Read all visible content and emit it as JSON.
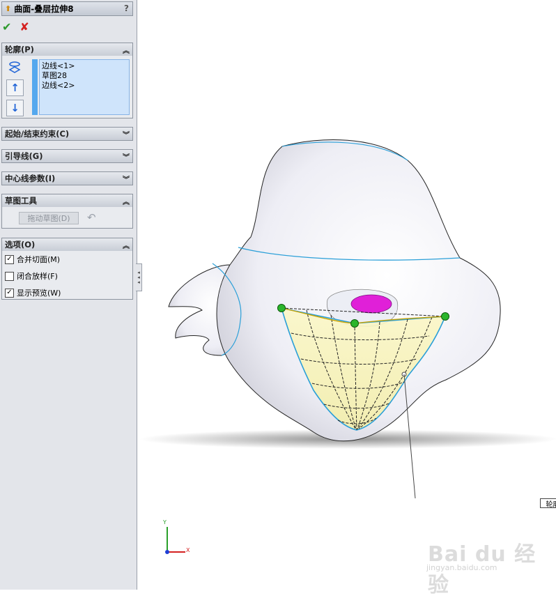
{
  "panel": {
    "title": "曲面-叠层拉伸8",
    "help_label": "?",
    "ok_symbol": "✔",
    "cancel_symbol": "✘",
    "groups": {
      "profile": {
        "label": "轮廓(P)",
        "items": [
          "边线<1>",
          "草图28",
          "边线<2>"
        ]
      },
      "start_end": {
        "label": "起始/结束约束(C)"
      },
      "guides": {
        "label": "引导线(G)"
      },
      "centerline": {
        "label": "中心线参数(I)"
      },
      "sketch_tools": {
        "label": "草图工具",
        "drag_button": "拖动草图(D)"
      },
      "options": {
        "label": "选项(O)",
        "items": [
          {
            "label": "合并切面(M)",
            "checked": true
          },
          {
            "label": "闭合放样(F)",
            "checked": false
          },
          {
            "label": "显示预览(W)",
            "checked": true
          }
        ]
      }
    }
  },
  "viewport": {
    "callout_label": "轮廓",
    "axis_x": "X",
    "axis_y": "Y",
    "watermark": "Bai du 经验",
    "watermark_url": "jingyan.baidu.com"
  },
  "colors": {
    "accent_blue": "#55a8ee",
    "ok_green": "#2e9a2e",
    "cancel_red": "#d42020",
    "nose_magenta": "#e020d8",
    "edge_cyan": "#2a9fd8"
  }
}
